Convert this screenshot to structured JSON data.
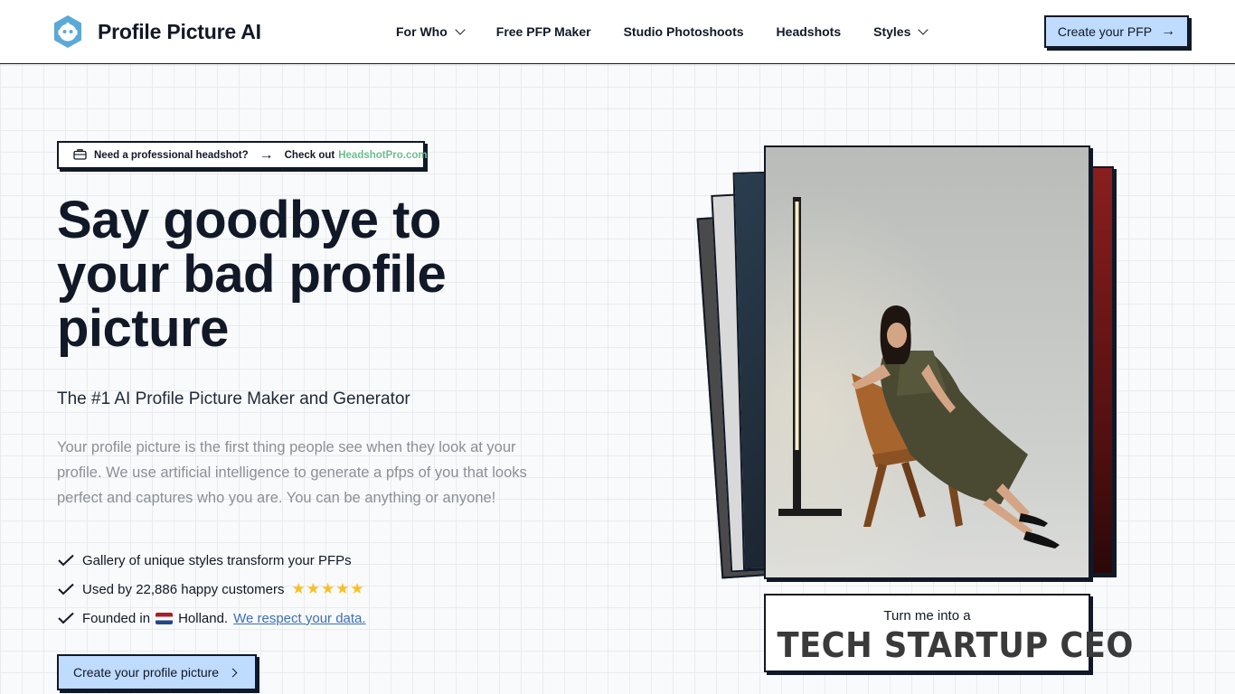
{
  "header": {
    "brand": "Profile Picture AI",
    "nav": [
      {
        "label": "For Who",
        "dropdown": true
      },
      {
        "label": "Free PFP Maker",
        "dropdown": false
      },
      {
        "label": "Studio Photoshoots",
        "dropdown": false
      },
      {
        "label": "Headshots",
        "dropdown": false
      },
      {
        "label": "Styles",
        "dropdown": true
      }
    ],
    "cta": "Create your PFP"
  },
  "banner": {
    "question": "Need a professional headshot?",
    "check_out": "Check out",
    "link": "HeadshotPro.com"
  },
  "hero": {
    "title": "Say goodbye to your bad profile picture",
    "subtitle": "The #1 AI Profile Picture Maker and Generator",
    "description": "Your profile picture is the first thing people see when they look at your profile. We use artificial intelligence to generate a pfps of you that looks perfect and captures who you are. You can be anything or anyone!",
    "features": {
      "gallery": "Gallery of unique styles transform your PFPs",
      "used_by": "Used by 22,886 happy customers",
      "rating": 5,
      "founded": "Founded in",
      "country": "Holland.",
      "data_link": "We respect your data."
    },
    "cta": "Create your profile picture"
  },
  "showcase": {
    "caption_small": "Turn me into a",
    "caption_big": "TECH STARTUP CEO"
  },
  "colors": {
    "accent_button": "#bfdbfe",
    "ink": "#111827",
    "link_green": "#6bc08c",
    "link_blue": "#3b6fb6",
    "star": "#fbbf24"
  }
}
